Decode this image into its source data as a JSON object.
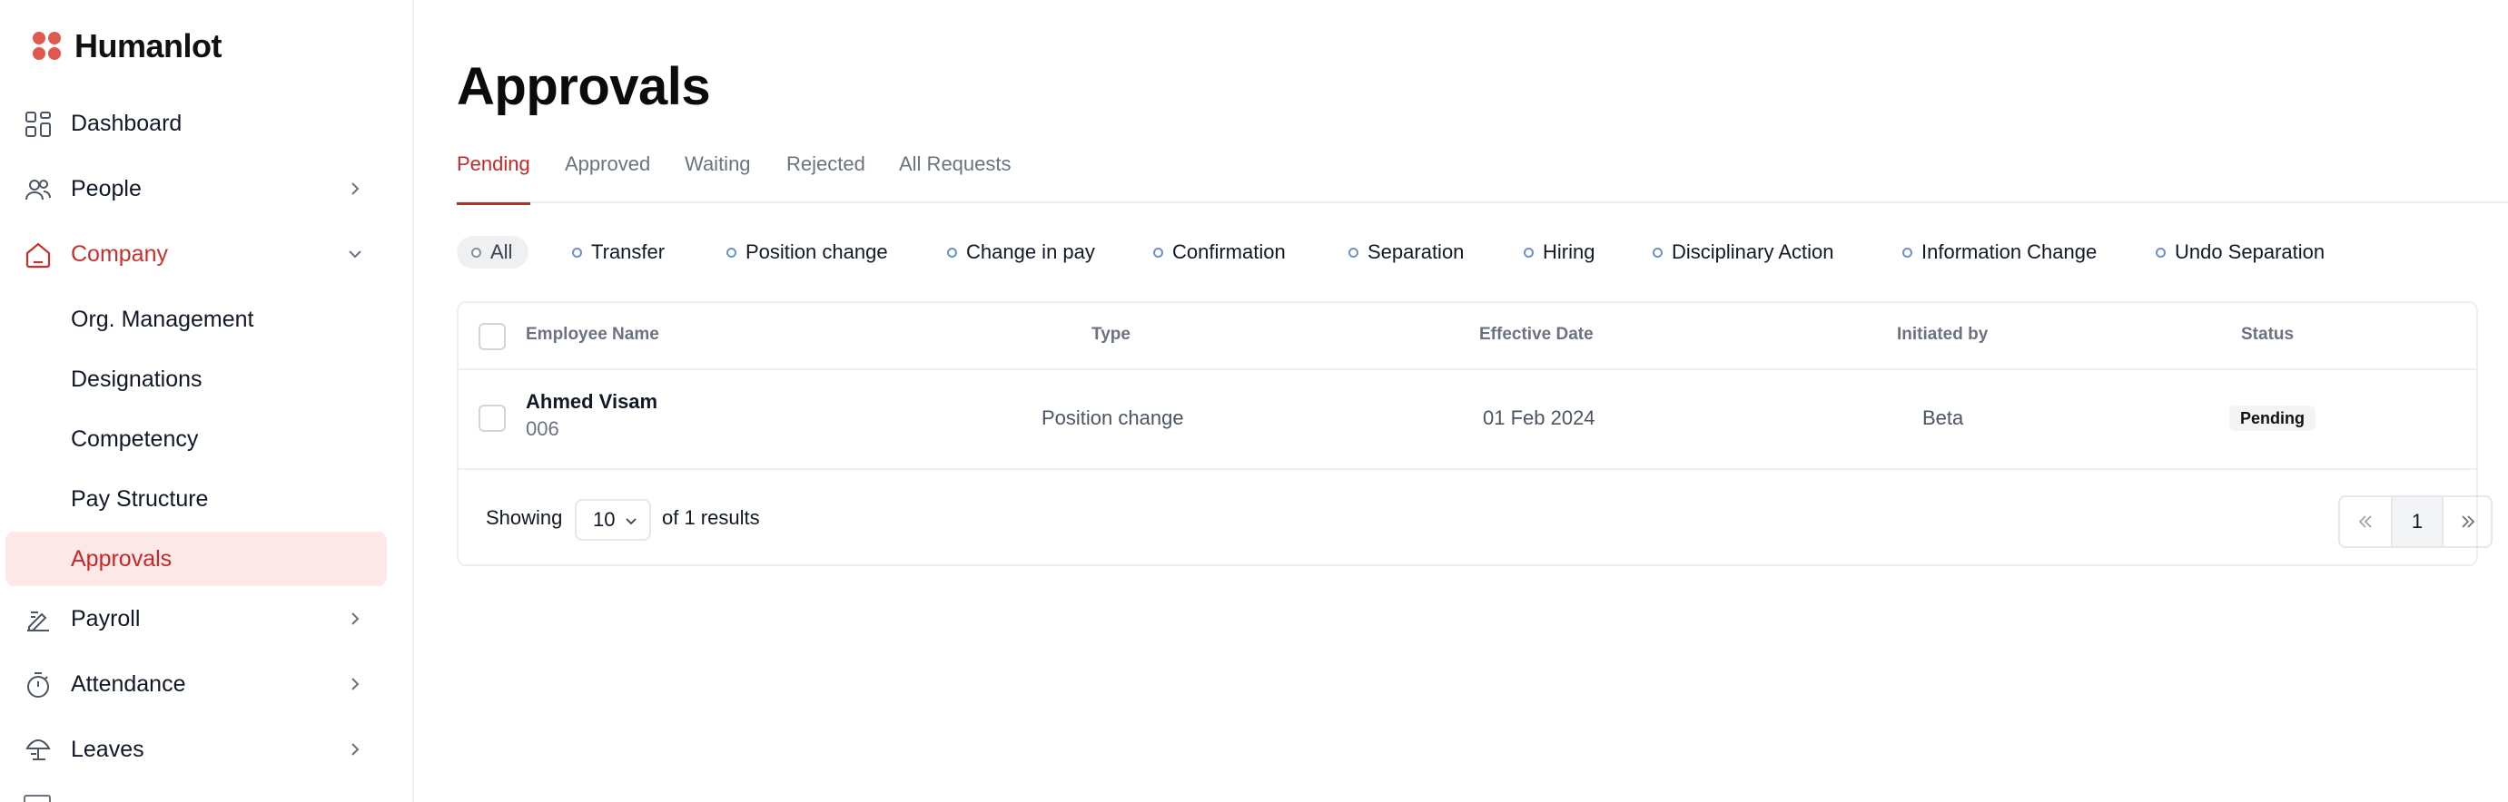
{
  "brand": {
    "name": "Humanlot",
    "color": "#e0584f"
  },
  "sidebar": {
    "items": [
      {
        "label": "Dashboard",
        "icon": "grid-icon"
      },
      {
        "label": "People",
        "icon": "people-icon"
      },
      {
        "label": "Company",
        "icon": "home-icon",
        "active": true
      },
      {
        "label": "Payroll",
        "icon": "payroll-icon"
      },
      {
        "label": "Attendance",
        "icon": "stopwatch-icon"
      },
      {
        "label": "Leaves",
        "icon": "umbrella-icon"
      }
    ],
    "company_sub": [
      {
        "label": "Org. Management"
      },
      {
        "label": "Designations"
      },
      {
        "label": "Competency"
      },
      {
        "label": "Pay Structure"
      },
      {
        "label": "Approvals",
        "selected": true
      }
    ]
  },
  "page": {
    "title": "Approvals"
  },
  "tabs": [
    {
      "label": "Pending",
      "active": true
    },
    {
      "label": "Approved"
    },
    {
      "label": "Waiting"
    },
    {
      "label": "Rejected"
    },
    {
      "label": "All Requests"
    }
  ],
  "filters": [
    {
      "label": "All",
      "active": true
    },
    {
      "label": "Transfer"
    },
    {
      "label": "Position change"
    },
    {
      "label": "Change in pay"
    },
    {
      "label": "Confirmation"
    },
    {
      "label": "Separation"
    },
    {
      "label": "Hiring"
    },
    {
      "label": "Disciplinary Action"
    },
    {
      "label": "Information Change"
    },
    {
      "label": "Undo Separation"
    }
  ],
  "table": {
    "columns": [
      "Employee Name",
      "Type",
      "Effective Date",
      "Initiated by",
      "Status"
    ],
    "rows": [
      {
        "name": "Ahmed Visam",
        "id": "006",
        "type": "Position change",
        "effective_date": "01 Feb 2024",
        "initiated_by": "Beta",
        "status": "Pending"
      }
    ]
  },
  "pagination": {
    "showing_label": "Showing",
    "per_page": "10",
    "results_label": "of 1 results",
    "current_page": "1"
  },
  "colors": {
    "accent": "#c62828",
    "selected_bg": "#fde8e8"
  }
}
